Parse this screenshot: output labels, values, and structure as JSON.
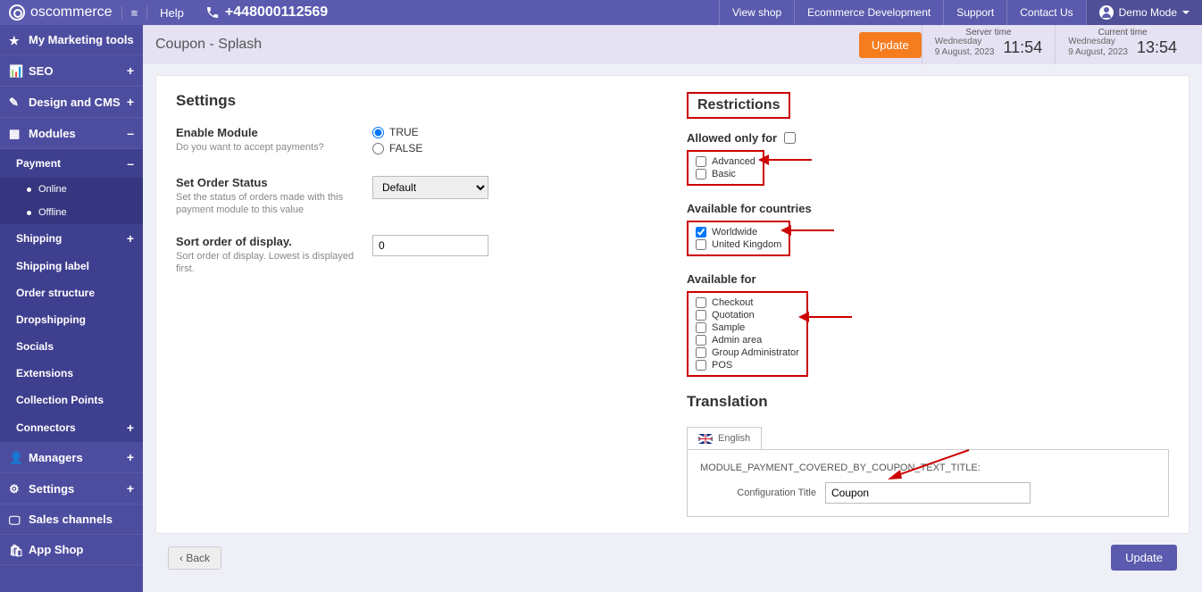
{
  "brand": "oscommerce",
  "topnav": {
    "help": "Help",
    "phone": "+448000112569",
    "view_shop": "View shop",
    "ecom_dev": "Ecommerce Development",
    "support": "Support",
    "contact": "Contact Us",
    "demo_mode": "Demo Mode"
  },
  "sidebar": {
    "marketing": "My Marketing tools",
    "seo": "SEO",
    "design": "Design and CMS",
    "modules": "Modules",
    "payment": "Payment",
    "online": "Online",
    "offline": "Offline",
    "shipping": "Shipping",
    "shipping_label": "Shipping label",
    "order_structure": "Order structure",
    "dropshipping": "Dropshipping",
    "socials": "Socials",
    "extensions": "Extensions",
    "collection_points": "Collection Points",
    "connectors": "Connectors",
    "managers": "Managers",
    "settings": "Settings",
    "sales_channels": "Sales channels",
    "app_shop": "App Shop"
  },
  "page": {
    "title": "Coupon - Splash",
    "update_btn": "Update",
    "server_time_label": "Server time",
    "current_time_label": "Current time",
    "server_day": "Wednesday",
    "server_date": "9 August, 2023",
    "server_time": "11:54",
    "current_day": "Wednesday",
    "current_date": "9 August, 2023",
    "current_time": "13:54"
  },
  "settings": {
    "heading": "Settings",
    "enable_title": "Enable Module",
    "enable_help": "Do you want to accept payments?",
    "true_label": "TRUE",
    "false_label": "FALSE",
    "status_title": "Set Order Status",
    "status_help": "Set the status of orders made with this payment module to this value",
    "status_value": "Default",
    "sort_title": "Sort order of display.",
    "sort_help": "Sort order of display. Lowest is displayed first.",
    "sort_value": "0"
  },
  "restrictions": {
    "heading": "Restrictions",
    "allowed_only_for": "Allowed only for",
    "advanced": "Advanced",
    "basic": "Basic",
    "avail_countries": "Available for countries",
    "worldwide": "Worldwide",
    "uk": "United Kingdom",
    "avail_for": "Available for",
    "checkout": "Checkout",
    "quotation": "Quotation",
    "sample": "Sample",
    "admin_area": "Admin area",
    "group_admin": "Group Administrator",
    "pos": "POS"
  },
  "translation": {
    "heading": "Translation",
    "tab_english": "English",
    "const": "MODULE_PAYMENT_COVERED_BY_COUPON_TEXT_TITLE:",
    "field_label": "Configuration Title",
    "field_value": "Coupon"
  },
  "bottom": {
    "back": "Back",
    "update": "Update"
  }
}
